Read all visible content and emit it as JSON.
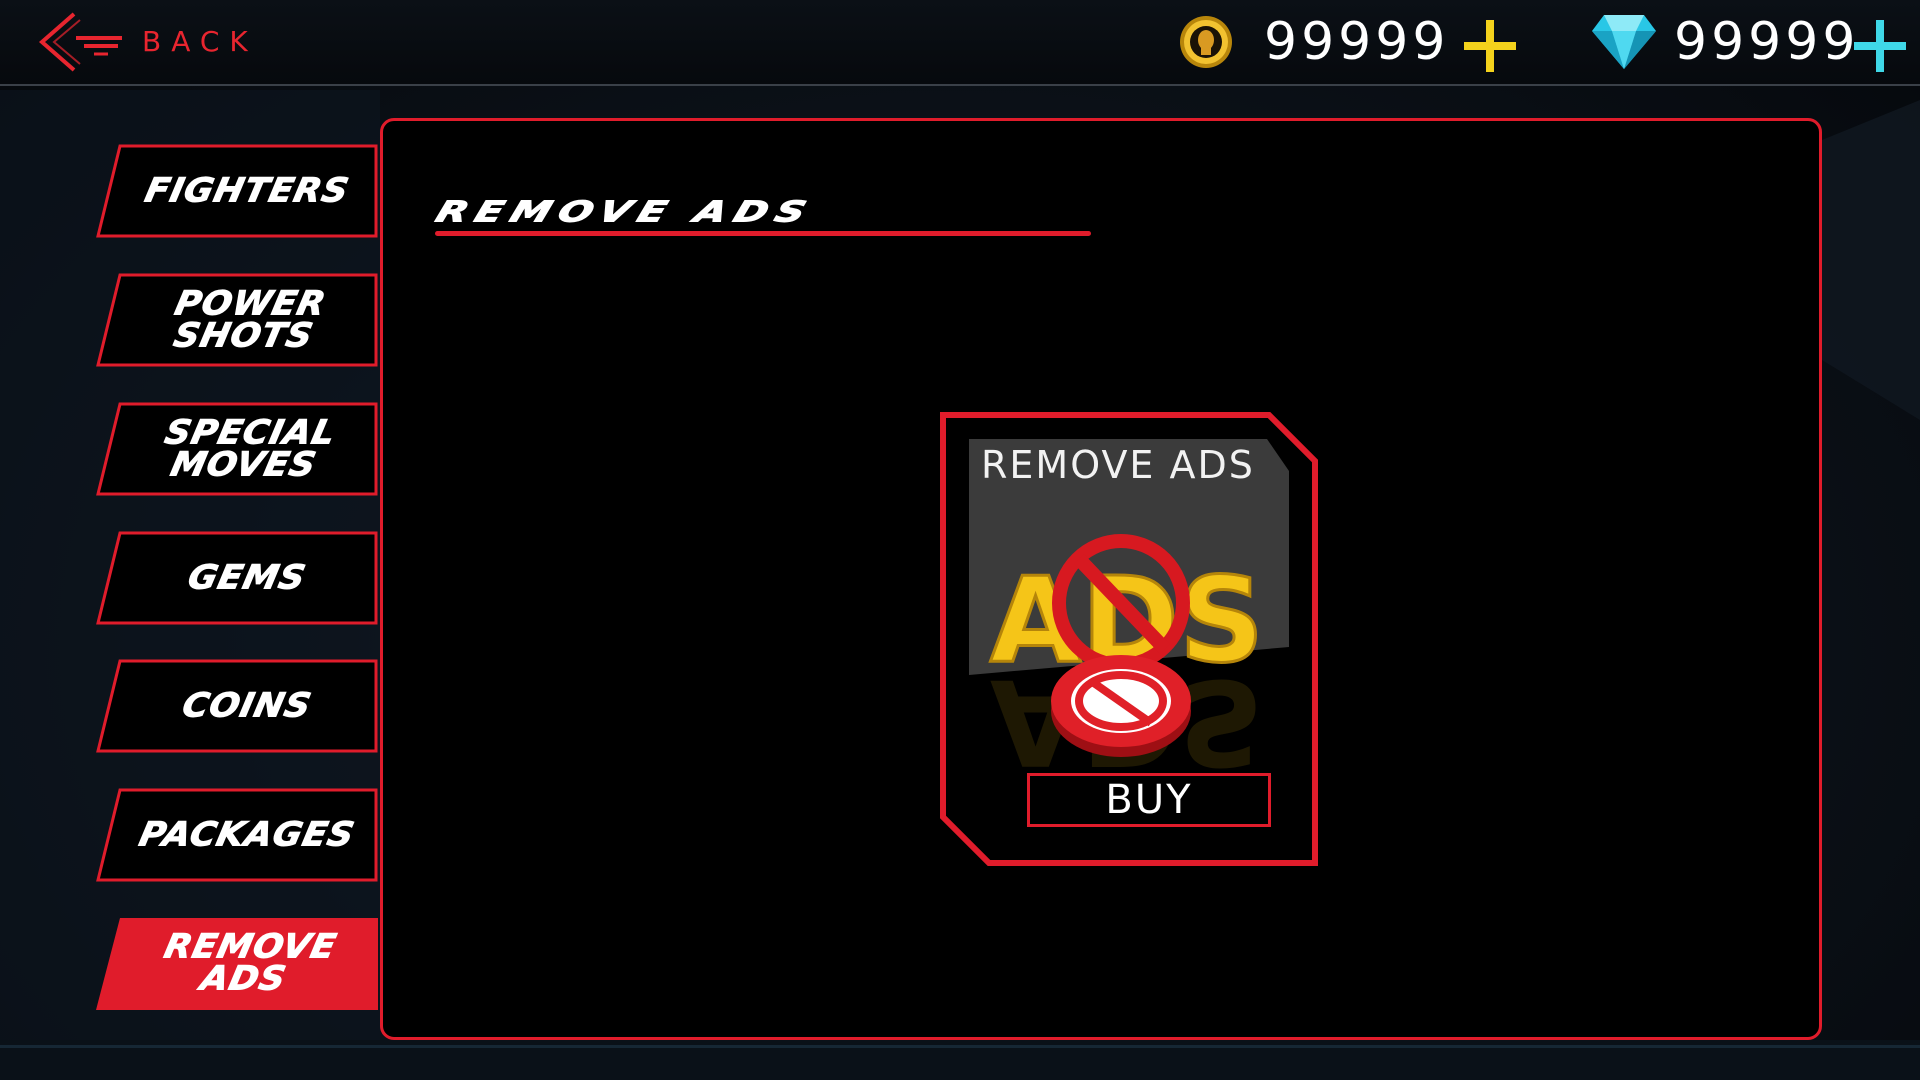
{
  "header": {
    "back_label": "BACK",
    "coins": {
      "value": "99999",
      "icon": "coin-icon",
      "plus_color": "#f4d21c"
    },
    "gems": {
      "value": "99999",
      "icon": "gem-icon",
      "plus_color": "#3fd8e8"
    }
  },
  "sidebar": {
    "items": [
      {
        "label": "FIGHTERS",
        "active": false
      },
      {
        "label": "POWER\nSHOTS",
        "active": false
      },
      {
        "label": "SPECIAL\nMOVES",
        "active": false
      },
      {
        "label": "GEMS",
        "active": false
      },
      {
        "label": "COINS",
        "active": false
      },
      {
        "label": "PACKAGES",
        "active": false
      },
      {
        "label": "REMOVE\nADS",
        "active": true
      }
    ]
  },
  "main": {
    "title": "REMOVE ADS",
    "card": {
      "title": "REMOVE ADS",
      "art_text": "ADS",
      "buy_label": "BUY"
    }
  },
  "colors": {
    "accent": "#e01c2b",
    "panel_bg": "#000000",
    "card_header": "#3b3b3b"
  }
}
